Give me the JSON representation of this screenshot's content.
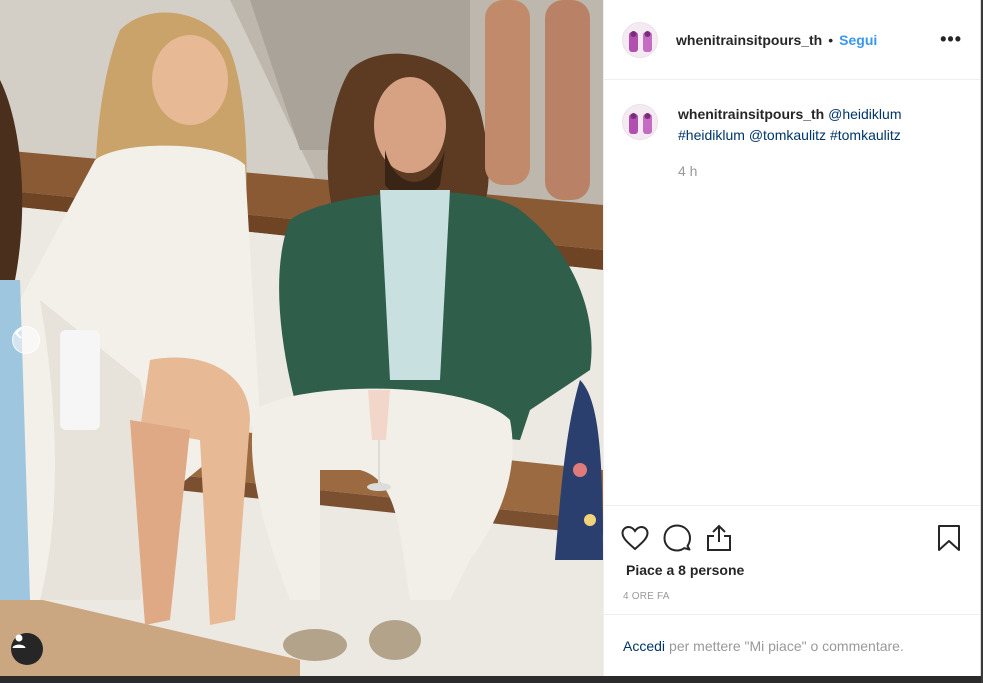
{
  "post": {
    "username": "whenitrainsitpours_th",
    "dot": "•",
    "follow_label": "Segui",
    "more_label": "•••",
    "caption": {
      "username": "whenitrainsitpours_th",
      "mention_1": "@heidiklum",
      "hashtag_1": "#heidiklum",
      "mention_2": "@tomkaulitz",
      "hashtag_2": "#tomkaulitz",
      "time": "4 h"
    },
    "likes_text": "Piace a 8 persone",
    "posted_ago": "4 ORE FA"
  },
  "login_prompt": {
    "login_label": "Accedi",
    "rest_text": "per mettere \"Mi piace\" o commentare."
  },
  "icons": {
    "like": "heart-icon",
    "comment": "comment-icon",
    "share": "share-icon",
    "save": "bookmark-icon",
    "carousel_prev": "chevron-left-icon",
    "tagged_users": "user-icon"
  },
  "colors": {
    "link_blue": "#3897f0",
    "mention_blue": "#003569",
    "muted_gray": "#999999",
    "text_dark": "#262626"
  }
}
